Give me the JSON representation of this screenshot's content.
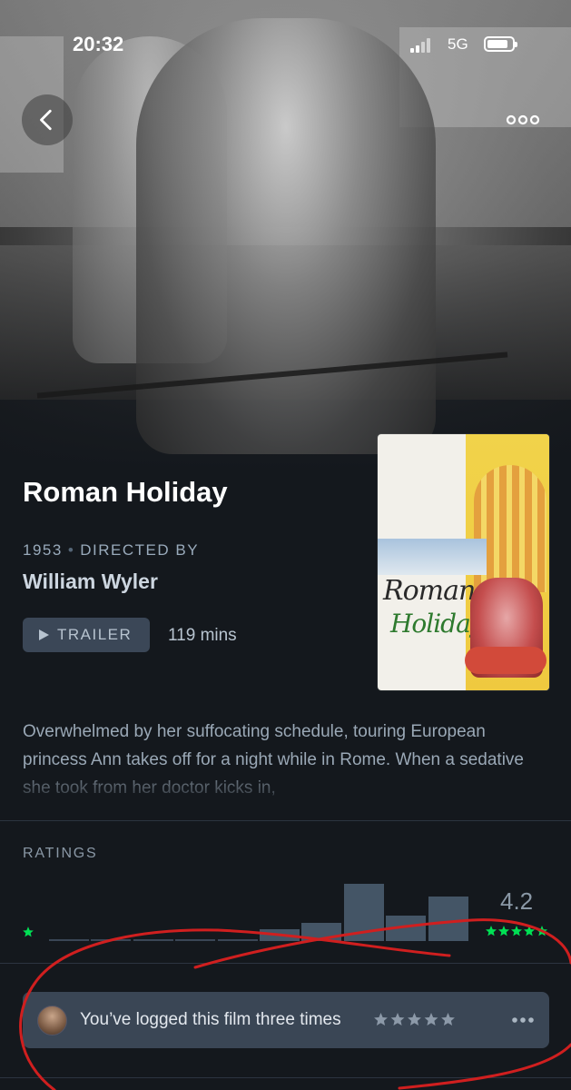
{
  "status_bar": {
    "time": "20:32",
    "network": "5G"
  },
  "film": {
    "title": "Roman Holiday",
    "year": "1953",
    "directed_by_label": "DIRECTED BY",
    "director": "William Wyler",
    "trailer_label": "TRAILER",
    "runtime": "119 mins",
    "synopsis": "Overwhelmed by her suffocating schedule, touring European princess Ann takes off for a night while in Rome. When a sedative she took from her doctor kicks in,",
    "poster": {
      "title_line1": "Roman",
      "title_line2": "Holiday"
    }
  },
  "ratings": {
    "label": "RATINGS",
    "average": "4.2",
    "histogram_fractions": [
      0.02,
      0.02,
      0.02,
      0.02,
      0.02,
      0.21,
      0.31,
      1.0,
      0.44,
      0.77
    ],
    "low_star_color": "#40bcf4",
    "high_star_color": "#00e054"
  },
  "log": {
    "text": "You’ve logged this film three times",
    "stars": 5
  },
  "colors": {
    "background": "#14181d",
    "accent_green": "#00e054",
    "card": "#3a4655",
    "annotation_red": "#d01f1f"
  }
}
